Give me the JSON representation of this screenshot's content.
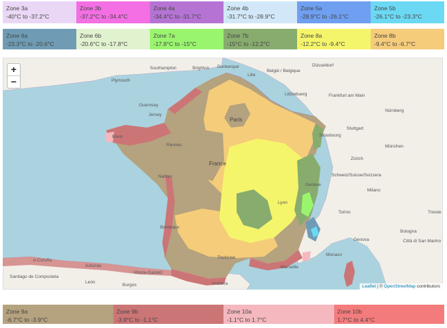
{
  "legend_top": [
    {
      "zone": "Zone 3a",
      "range": "-40°C to -37.2°C",
      "color": "#ead7f5"
    },
    {
      "zone": "Zone 3b",
      "range": "-37.2°C to -34.4°C",
      "color": "#f36fe3"
    },
    {
      "zone": "Zone 4a",
      "range": "-34.4°C to -31.7°C",
      "color": "#b574d4"
    },
    {
      "zone": "Zone 4b",
      "range": "-31.7°C to -28.9°C",
      "color": "#d2e8f8"
    },
    {
      "zone": "Zone 5a",
      "range": "-28.9°C to -26.1°C",
      "color": "#6f9ff0"
    },
    {
      "zone": "Zone 5b",
      "range": "-26.1°C to -23.3°C",
      "color": "#6cd9f4"
    }
  ],
  "legend_mid": [
    {
      "zone": "Zone 6a",
      "range": "-23.3°C to -20.6°C",
      "color": "#6f9cb4"
    },
    {
      "zone": "Zone 6b",
      "range": "-20.6°C to -17.8°C",
      "color": "#e1f2cf"
    },
    {
      "zone": "Zone 7a",
      "range": "-17.8°C to -15°C",
      "color": "#9af56e"
    },
    {
      "zone": "Zone 7b",
      "range": "-15°C to -12.2°C",
      "color": "#87ac6e"
    },
    {
      "zone": "Zone 8a",
      "range": "-12.2°C to -9.4°C",
      "color": "#f5f56b"
    },
    {
      "zone": "Zone 8b",
      "range": "-9.4°C to -6.7°C",
      "color": "#f5cc7a"
    }
  ],
  "legend_bottom": [
    {
      "zone": "Zone 9a",
      "range": "-6.7°C to -3.9°C",
      "color": "#b5a27e"
    },
    {
      "zone": "Zone 9b",
      "range": "-3.9°C to -1.1°C",
      "color": "#cc7576"
    },
    {
      "zone": "Zone 10a",
      "range": "-1.1°C to 1.7°C",
      "color": "#f5b8bf"
    },
    {
      "zone": "Zone 10b",
      "range": "1.7°C to 4.4°C",
      "color": "#f47b7c"
    }
  ],
  "map": {
    "zoom_in": "+",
    "zoom_out": "−",
    "attribution": {
      "leaflet": "Leaflet",
      "sep": " | © ",
      "osm": "OpenStreetMap",
      "suffix": " contributors"
    },
    "labels": {
      "paris": "Paris",
      "france": "France",
      "rennes": "Rennes",
      "bordeaux": "Bordeaux",
      "toulouse": "Toulouse",
      "lyon": "Lyon",
      "marseille": "Marseille",
      "nantes": "Nantes",
      "brest": "Brest",
      "lille": "Lille",
      "strasbourg": "Strasbourg",
      "guernsey": "Guernsey",
      "jersey": "Jersey",
      "southampton": "Southampton",
      "brighton": "Brighton",
      "plymouth": "Plymouth",
      "dunkerque": "Dunkerque",
      "belgique": "België / Belgique",
      "dusseldorf": "Düsseldorf",
      "frankfurt": "Frankfurt am Main",
      "nurnberg": "Nürnberg",
      "munchen": "München",
      "stuttgart": "Stuttgart",
      "zurich": "Zürich",
      "schweiz": "Schweiz/Suisse/Svizzera",
      "geneve": "Genève",
      "milano": "Milano",
      "torino": "Torino",
      "genova": "Genova",
      "bologna": "Bologna",
      "trieste": "Trieste",
      "sanmarino": "Città di San Marino",
      "monaco": "Monaco",
      "coruna": "A Coruña",
      "santiago": "Santiago de Compostela",
      "gasteiz": "Vitoria-Gasteiz",
      "burgos": "Burgos",
      "andorra": "Andorra",
      "leon": "León",
      "asturias": "Asturias",
      "luxembourg": "Lëtzebuerg"
    }
  }
}
